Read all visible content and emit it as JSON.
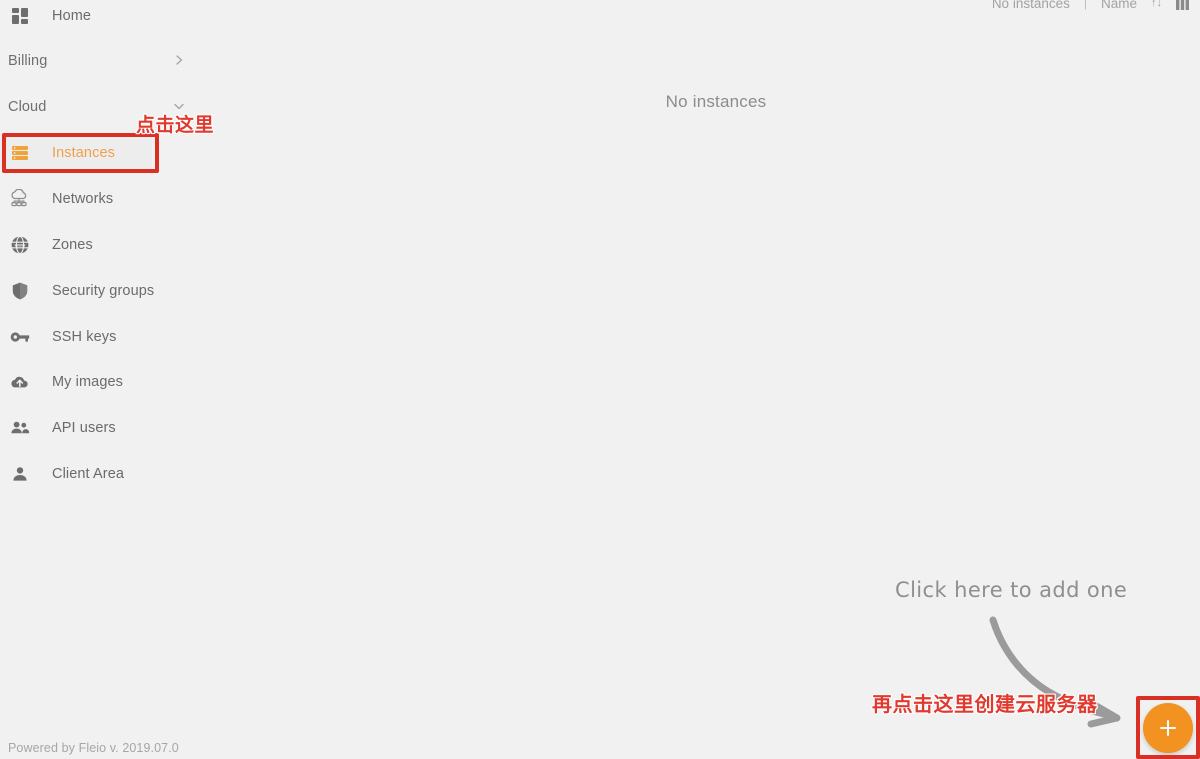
{
  "app": {
    "background_color": "#f1f1f1",
    "accent_color": "#f29220"
  },
  "sidebar": {
    "home": {
      "label": "Home",
      "icon": "dashboard-grid-icon"
    },
    "groups": [
      {
        "label": "Billing",
        "expanded": false,
        "chevron": "chevron-right-icon"
      },
      {
        "label": "Cloud",
        "expanded": true,
        "chevron": "chevron-down-icon"
      }
    ],
    "items": [
      {
        "label": "Instances",
        "icon": "server-stack-icon",
        "active": true
      },
      {
        "label": "Networks",
        "icon": "cloud-network-icon",
        "active": false
      },
      {
        "label": "Zones",
        "icon": "globe-www-icon",
        "active": false
      },
      {
        "label": "Security groups",
        "icon": "shield-icon",
        "active": false
      },
      {
        "label": "SSH keys",
        "icon": "key-icon",
        "active": false
      },
      {
        "label": "My images",
        "icon": "cloud-upload-icon",
        "active": false
      },
      {
        "label": "API users",
        "icon": "users-icon",
        "active": false
      },
      {
        "label": "Client Area",
        "icon": "user-icon",
        "active": false
      }
    ]
  },
  "toolbar": {
    "count_label": "No instances",
    "separator": "|",
    "sort_label": "Name",
    "sort_arrows": "↑↓",
    "view_icon": "grid-view-icon"
  },
  "main": {
    "empty_state_text": "No instances",
    "hint_text": "Click here to add one",
    "hint_arrow_icon": "curved-arrow-icon"
  },
  "fab": {
    "icon": "plus-icon",
    "label": "+",
    "color": "#f29220"
  },
  "footer": {
    "text": "Powered by Fleio v. 2019.07.0"
  },
  "annotations": {
    "box_color": "#d93025",
    "text_color": "#e03a2f",
    "instances_note": "点击这里",
    "fab_note": "再点击这里创建云服务器"
  }
}
